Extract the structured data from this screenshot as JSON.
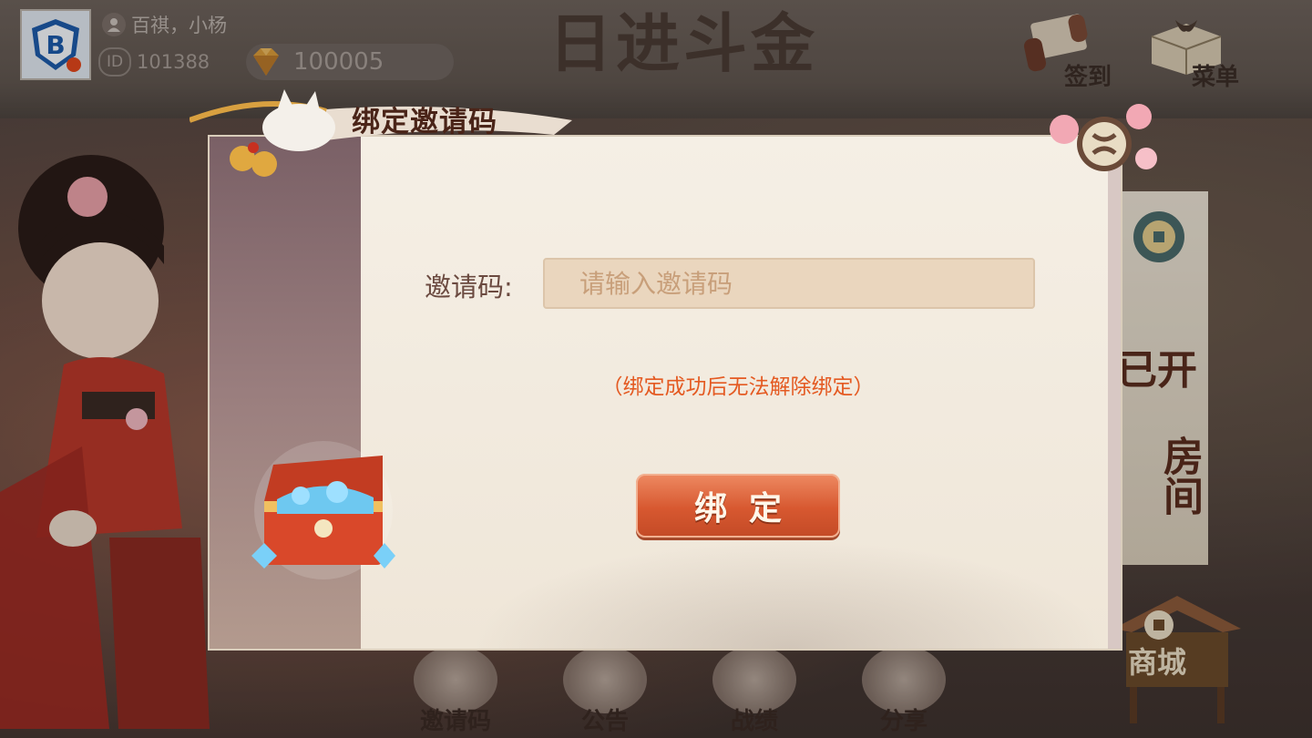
{
  "header": {
    "player_name": "百祺，小杨",
    "id_badge": "ID",
    "player_id": "101388",
    "gem_count": "100005",
    "title": "日进斗金",
    "sign_in_label": "签到",
    "menu_label": "菜单"
  },
  "right_panel": {
    "room_text_1": "已开",
    "room_text_2": "房间",
    "shop_label": "商城"
  },
  "bottom_nav": {
    "items": [
      {
        "label": "邀请码"
      },
      {
        "label": "公告"
      },
      {
        "label": "战绩"
      },
      {
        "label": "分享"
      }
    ]
  },
  "modal": {
    "title": "绑定邀请码",
    "invite_label": "邀请码:",
    "input_placeholder": "请输入邀请码",
    "input_value": "",
    "note": "（绑定成功后无法解除绑定）",
    "bind_button": "绑定"
  },
  "colors": {
    "note_text": "#e45a22",
    "bind_button": "#d75830",
    "input_bg": "#ead6be",
    "modal_bg": "#f2ebe0"
  },
  "icons": [
    "shield-logo-icon",
    "user-icon",
    "diamond-icon",
    "scroll-icon",
    "gift-box-icon",
    "close-icon",
    "treasure-chest-icon",
    "coin-icon"
  ]
}
